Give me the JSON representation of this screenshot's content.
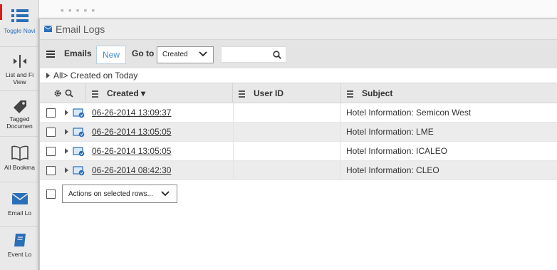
{
  "sidebar": {
    "items": [
      {
        "label": "Toggle Navi",
        "icon": "list-icon"
      },
      {
        "label": "List and Fi\nView",
        "label_line1": "List and Fi",
        "label_line2": "View",
        "icon": "split-view-icon"
      },
      {
        "label_line1": "Tagged",
        "label_line2": "Documen",
        "icon": "tag-icon"
      },
      {
        "label": "All Bookma",
        "icon": "book-icon"
      },
      {
        "label": "Email Lo",
        "icon": "envelope-icon"
      },
      {
        "label": "Event Lo",
        "icon": "notebook-icon"
      }
    ]
  },
  "panel": {
    "title": "Email Logs",
    "toolbar": {
      "emails_label": "Emails",
      "new_label": "New",
      "goto_label": "Go to",
      "goto_value": "Created",
      "search_value": ""
    },
    "breadcrumb": {
      "root": "All",
      "separator": ">",
      "current": "Created on Today"
    },
    "table": {
      "columns": [
        {
          "label": ""
        },
        {
          "label": "Created ▾"
        },
        {
          "label": "User ID"
        },
        {
          "label": "Subject"
        }
      ],
      "rows": [
        {
          "created": "06-26-2014 13:09:37",
          "user_id": "",
          "subject": "Hotel Information: Semicon West"
        },
        {
          "created": "06-26-2014 13:05:05",
          "user_id": "",
          "subject": "Hotel Information: LME"
        },
        {
          "created": "06-26-2014 13:05:05",
          "user_id": "",
          "subject": "Hotel Information: ICALEO"
        },
        {
          "created": "06-26-2014 08:42:30",
          "user_id": "",
          "subject": "Hotel Information: CLEO"
        }
      ]
    },
    "footer": {
      "actions_label": "Actions on selected rows..."
    }
  },
  "colors": {
    "accent": "#2a6fb8",
    "link": "#3d8bd6",
    "red_marker": "#e01b1b",
    "header_bg": "#e8e8e8",
    "alt_row_bg": "#ececec"
  }
}
